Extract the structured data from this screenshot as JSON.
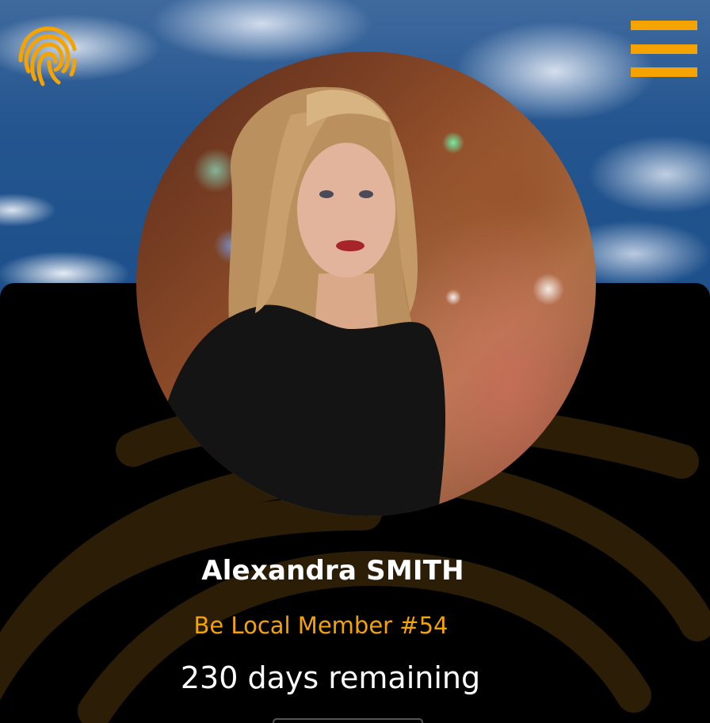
{
  "header": {
    "logo_icon": "fingerprint-icon",
    "menu_icon": "hamburger-menu-icon"
  },
  "profile": {
    "photo": "profile-photo",
    "name": "Alexandra SMITH",
    "membership": "Be Local Member #54",
    "days_remaining": "230 days remaining"
  },
  "colors": {
    "accent": "#f5a300",
    "card_background": "#000000",
    "text_primary": "#ffffff",
    "watermark": "#2b1d06"
  }
}
